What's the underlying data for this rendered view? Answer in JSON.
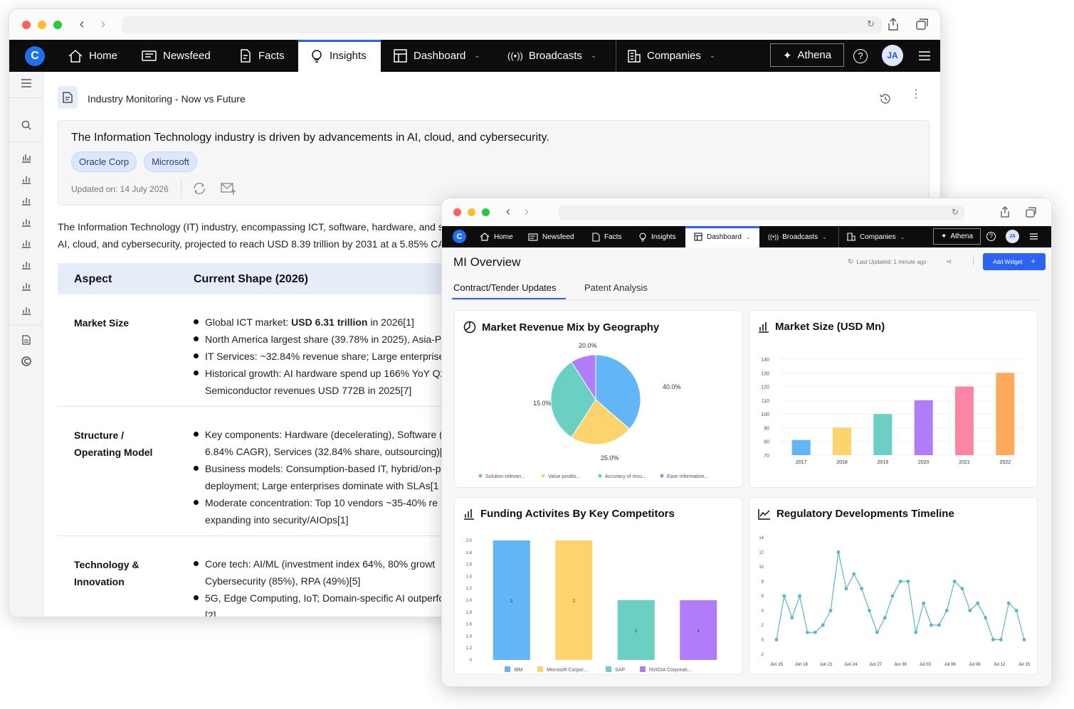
{
  "nav": {
    "logo": "C",
    "items": [
      "Home",
      "Newsfeed",
      "Facts",
      "Insights",
      "Dashboard",
      "Broadcasts",
      "Companies"
    ],
    "athena": "Athena",
    "avatar": "JA"
  },
  "page": {
    "title": "Industry Monitoring - Now vs Future",
    "headline": "The Information Technology industry is driven by advancements in AI, cloud, and cybersecurity.",
    "tags": [
      "Oracle Corp",
      "Microsoft"
    ],
    "updated": "Updated on: 14 July 2026",
    "intro_line1": "The Information Technology (IT) industry, encompassing ICT, software, hardware, and s",
    "intro_line2": "AI, cloud, and cybersecurity, projected to reach USD 8.39 trillion by 2031 at a 5.85% CA"
  },
  "table": {
    "col1": "Aspect",
    "col2": "Current Shape (2026)",
    "rows": [
      {
        "aspect": "Market Size",
        "bullets": [
          {
            "pre": "Global ICT market: ",
            "bold": "USD 6.31 trillion",
            "post": " in 2026[1]"
          },
          {
            "pre": "North America largest share (39.78% in 2025), Asia-P",
            "bold": "",
            "post": ""
          },
          {
            "pre": "IT Services: ~32.84% revenue share; Large enterprise",
            "bold": "",
            "post": ""
          },
          {
            "pre": "Historical growth: AI hardware spend up 166% YoY Q2",
            "bold": "",
            "post": "",
            "cont": "Semiconductor revenues USD 772B in 2025[7]"
          }
        ]
      },
      {
        "aspect": "Structure / Operating Model",
        "bullets": [
          {
            "pre": "Key components: Hardware (decelerating), Software (",
            "cont": "6.84% CAGR), Services (32.84% share, outsourcing)[1"
          },
          {
            "pre": "Business models: Consumption-based IT, hybrid/on-p",
            "cont": "deployment; Large enterprises dominate with SLAs[1"
          },
          {
            "pre": "Moderate concentration: Top 10 vendors ~35-40% re",
            "cont": "expanding into security/AIOps[1]"
          }
        ]
      },
      {
        "aspect": "Technology & Innovation",
        "bullets": [
          {
            "pre": "Core tech: AI/ML (investment index 64%, 80% growt",
            "cont": "Cybersecurity (85%), RPA (49%)[5]"
          },
          {
            "pre": "5G, Edge Computing, IoT; Domain-specific AI outperfo",
            "cont": "[2]"
          }
        ]
      }
    ]
  },
  "dashboard": {
    "title": "MI Overview",
    "last_updated": "Last Updated: 1 minute ago",
    "add_widget": "Add Widget",
    "tabs": [
      "Contract/Tender Updates",
      "Patent Analysis"
    ]
  },
  "colors": {
    "blue": "#62b5f7",
    "yellow": "#fdd36e",
    "teal": "#6ccfc4",
    "purple": "#b07cf7",
    "pink": "#fb86a3",
    "orange": "#fdaa5c",
    "line": "#5ab5c9",
    "accent": "#2d63f5"
  },
  "chart_data": [
    {
      "type": "pie",
      "title": "Market Revenue Mix by Geography",
      "labels": [
        "Solution relevan...",
        "Value positio...",
        "Accuracy of resu...",
        "Ease information..."
      ],
      "values": [
        40,
        25,
        35,
        10
      ],
      "slice_labels": [
        "40.0%",
        "25.0%",
        "15.0%",
        "20.0%"
      ],
      "legend": "bottom"
    },
    {
      "type": "bar",
      "title": "Market Size (USD Mn)",
      "categories": [
        "2017",
        "2018",
        "2019",
        "2020",
        "2021",
        "2022"
      ],
      "values": [
        81,
        90,
        100,
        110,
        120,
        130
      ],
      "ylim": [
        70,
        140
      ],
      "yticks": [
        70,
        80,
        90,
        100,
        110,
        120,
        130,
        140
      ]
    },
    {
      "type": "bar",
      "title": "Funding Activites By Key Competitors",
      "categories": [
        "IBM",
        "Microsoft Corpor...",
        "SAP",
        "NVIDIA Corporati..."
      ],
      "values": [
        2,
        2,
        1,
        1
      ],
      "ytick_labels": [
        "2.0",
        "1.8",
        "1.6",
        "1.4",
        "1.2",
        "1.0",
        "1.8",
        "1.6",
        "1.4",
        "1.2",
        "0"
      ],
      "legend": "bottom"
    },
    {
      "type": "line",
      "title": "Regulatory Developments Timeline",
      "x_labels": [
        "Jun 15",
        "Jun 18",
        "Jun 21",
        "Jun 24",
        "Jun 27",
        "Jun 30",
        "Jul 03",
        "Jul 06",
        "Jul 09",
        "Jul 12",
        "Jul 15"
      ],
      "values": [
        0,
        6,
        3,
        6,
        1,
        1,
        2,
        4,
        12,
        7,
        9,
        7,
        4,
        1,
        3,
        6,
        8,
        8,
        1,
        5,
        2,
        2,
        4,
        8,
        7,
        4,
        5,
        3,
        0,
        0,
        5,
        4,
        0
      ],
      "ylim": [
        -2,
        14
      ],
      "yticks": [
        -2,
        0,
        2,
        4,
        6,
        8,
        10,
        12,
        14
      ]
    }
  ]
}
